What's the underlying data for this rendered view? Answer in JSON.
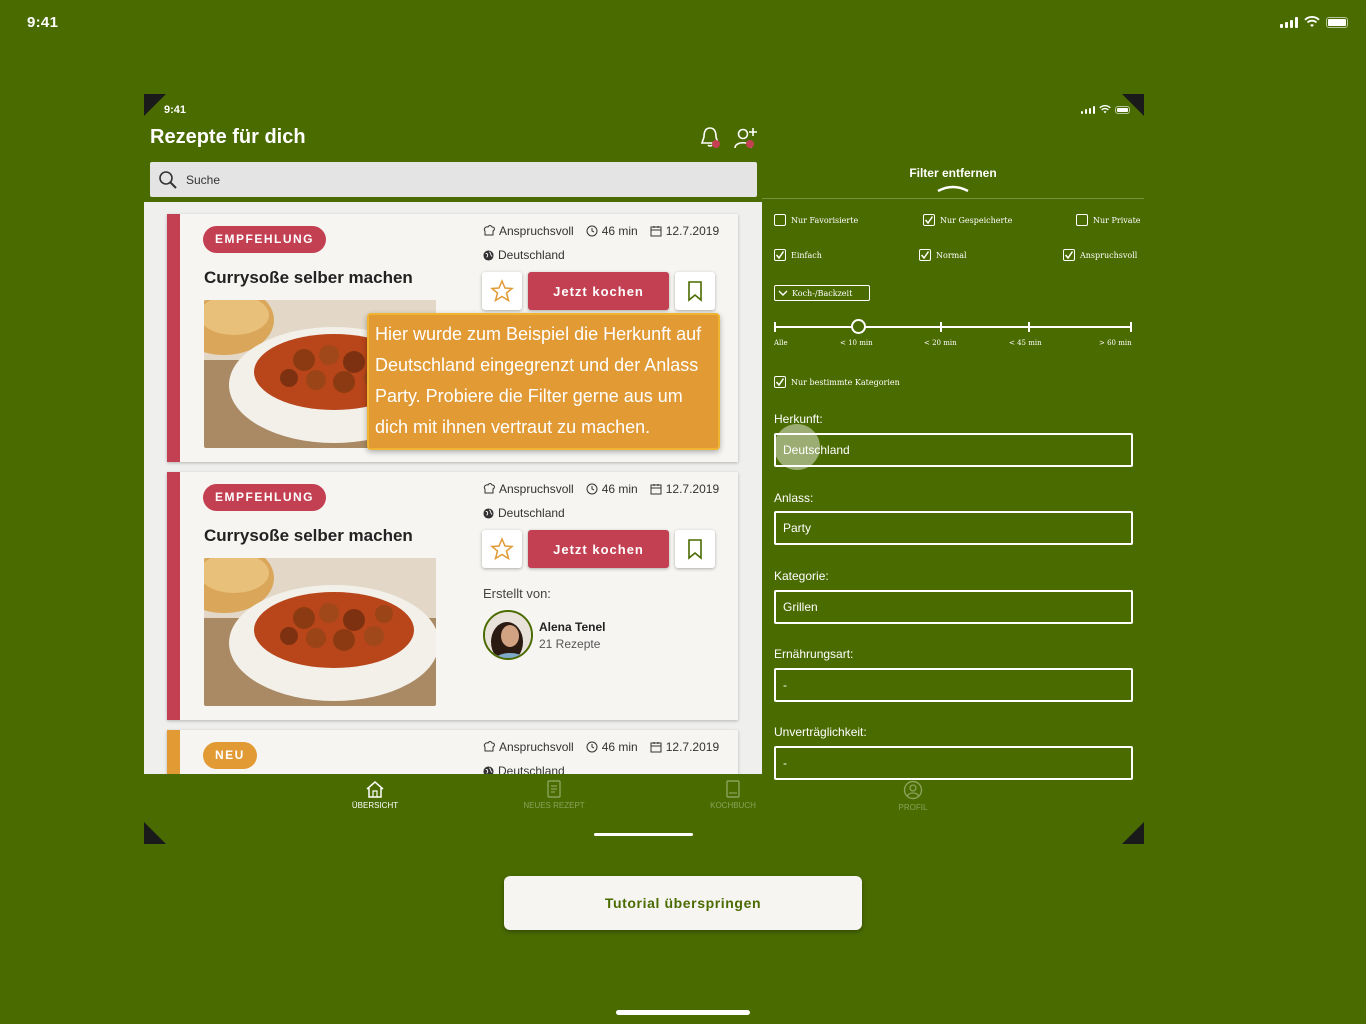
{
  "device": {
    "time": "9:41"
  },
  "app": {
    "time": "9:41",
    "title": "Rezepte für dich",
    "search_placeholder": "Suche",
    "cards": [
      {
        "badge": "EMPFEHLUNG",
        "title": "Currysoße selber machen",
        "difficulty": "Anspruchsvoll",
        "duration": "46 min",
        "date": "12.7.2019",
        "origin": "Deutschland",
        "cook_label": "Jetzt kochen"
      },
      {
        "badge": "EMPFEHLUNG",
        "title": "Currysoße selber machen",
        "difficulty": "Anspruchsvoll",
        "duration": "46 min",
        "date": "12.7.2019",
        "origin": "Deutschland",
        "cook_label": "Jetzt kochen",
        "created_by_label": "Erstellt von:",
        "author_name": "Alena Tenel",
        "author_recipes": "21 Rezepte"
      },
      {
        "badge": "NEU",
        "difficulty": "Anspruchsvoll",
        "duration": "46 min",
        "date": "12.7.2019",
        "origin": "Deutschland"
      }
    ],
    "tooltip": "Hier wurde zum Beispiel die Herkunft auf Deutschland eingegrenzt und der Anlass Party. Probiere die Filter gerne aus um dich mit ihnen vertraut zu machen.",
    "tabs": [
      {
        "label": "ÜBERSICHT",
        "icon": "home-icon",
        "active": true
      },
      {
        "label": "NEUES REZEPT",
        "icon": "new-recipe-icon",
        "active": false
      },
      {
        "label": "KOCHBUCH",
        "icon": "cookbook-icon",
        "active": false
      },
      {
        "label": "PROFIL",
        "icon": "profile-icon",
        "active": false
      }
    ]
  },
  "filter": {
    "title": "Filter entfernen",
    "checkboxes_row1": [
      {
        "label": "Nur Favorisierte",
        "checked": false
      },
      {
        "label": "Nur Gespeicherte",
        "checked": true
      },
      {
        "label": "Nur Private",
        "checked": false
      }
    ],
    "checkboxes_row2": [
      {
        "label": "Einfach",
        "checked": true
      },
      {
        "label": "Normal",
        "checked": true
      },
      {
        "label": "Anspruchsvoll",
        "checked": true
      }
    ],
    "time_dropdown": "Koch-/Backzeit",
    "slider_labels": [
      "Alle",
      "< 10 min",
      "< 20 min",
      "< 45 min",
      "> 60 min"
    ],
    "slider_selected_index": 1,
    "categories_checkbox": {
      "label": "Nur bestimmte Kategorien",
      "checked": true
    },
    "fields": [
      {
        "label": "Herkunft:",
        "value": "Deutschland"
      },
      {
        "label": "Anlass:",
        "value": "Party"
      },
      {
        "label": "Kategorie:",
        "value": "Grillen"
      },
      {
        "label": "Ernährungsart:",
        "value": "-"
      },
      {
        "label": "Unverträglichkeit:",
        "value": "-"
      }
    ]
  },
  "skip_button": "Tutorial überspringen",
  "colors": {
    "background": "#4a6b00",
    "accent": "#c34052",
    "neu": "#e29a35",
    "tooltip": "#e29a35"
  }
}
